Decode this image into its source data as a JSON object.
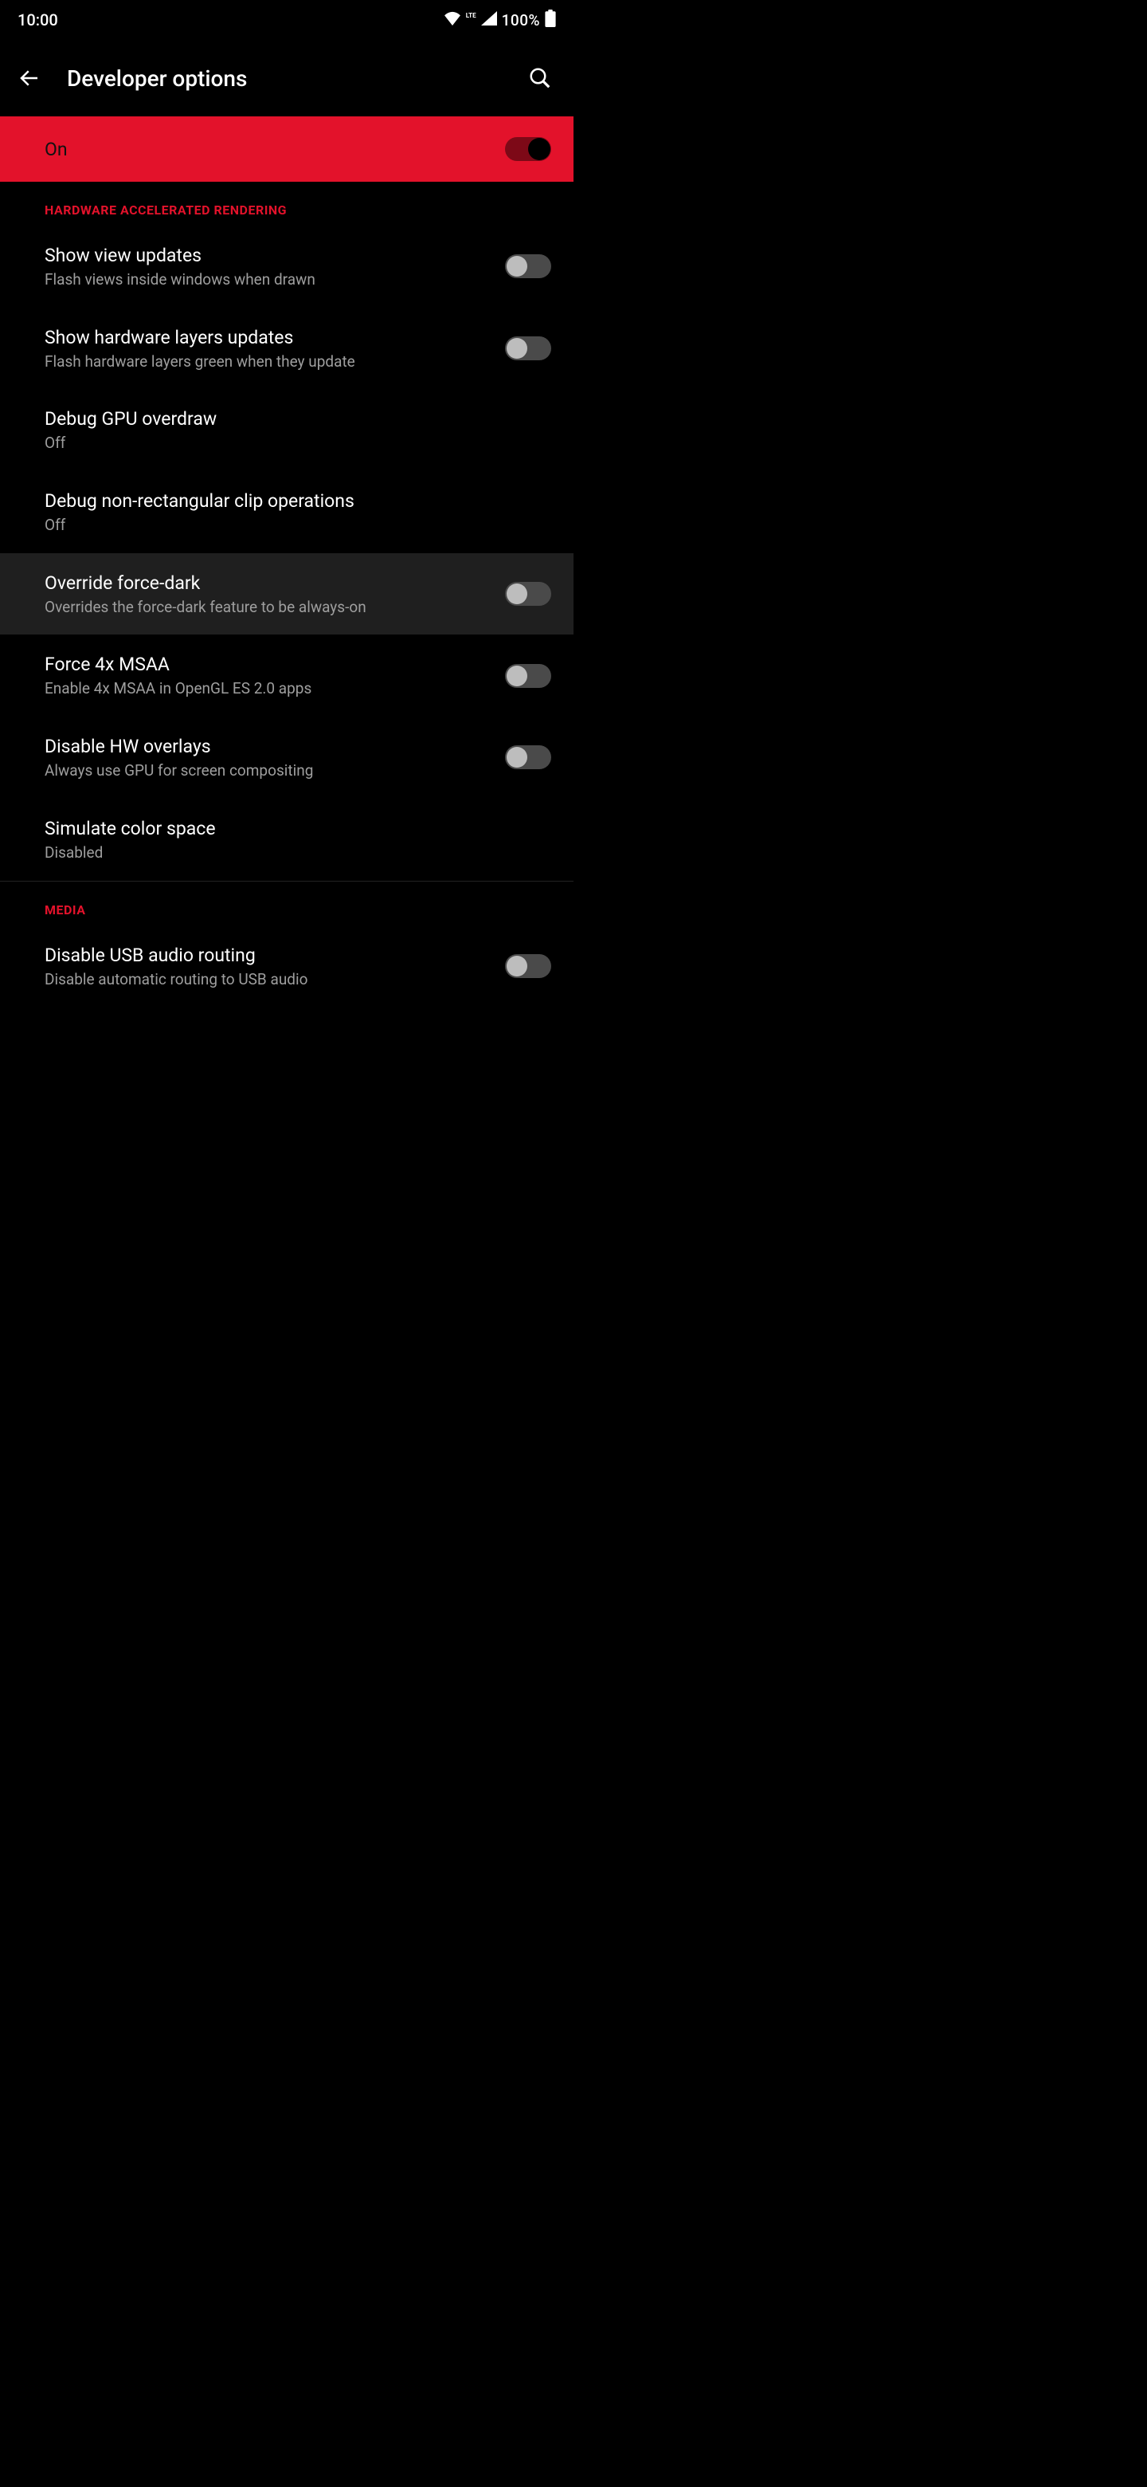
{
  "status": {
    "time": "10:00",
    "lte_label": "LTE",
    "battery_pct": "100%"
  },
  "appbar": {
    "title": "Developer options"
  },
  "master": {
    "label": "On",
    "on": true
  },
  "sections": [
    {
      "header": "HARDWARE ACCELERATED RENDERING",
      "items": [
        {
          "title": "Show view updates",
          "sub": "Flash views inside windows when drawn",
          "toggle": true,
          "on": false
        },
        {
          "title": "Show hardware layers updates",
          "sub": "Flash hardware layers green when they update",
          "toggle": true,
          "on": false
        },
        {
          "title": "Debug GPU overdraw",
          "sub": "Off",
          "toggle": false
        },
        {
          "title": "Debug non-rectangular clip operations",
          "sub": "Off",
          "toggle": false
        },
        {
          "title": "Override force-dark",
          "sub": "Overrides the force-dark feature to be always-on",
          "toggle": true,
          "on": false,
          "highlight": true
        },
        {
          "title": "Force 4x MSAA",
          "sub": "Enable 4x MSAA in OpenGL ES 2.0 apps",
          "toggle": true,
          "on": false
        },
        {
          "title": "Disable HW overlays",
          "sub": "Always use GPU for screen compositing",
          "toggle": true,
          "on": false
        },
        {
          "title": "Simulate color space",
          "sub": "Disabled",
          "toggle": false
        }
      ]
    },
    {
      "header": "MEDIA",
      "items": [
        {
          "title": "Disable USB audio routing",
          "sub": "Disable automatic routing to USB audio",
          "toggle": true,
          "on": false
        }
      ]
    }
  ]
}
